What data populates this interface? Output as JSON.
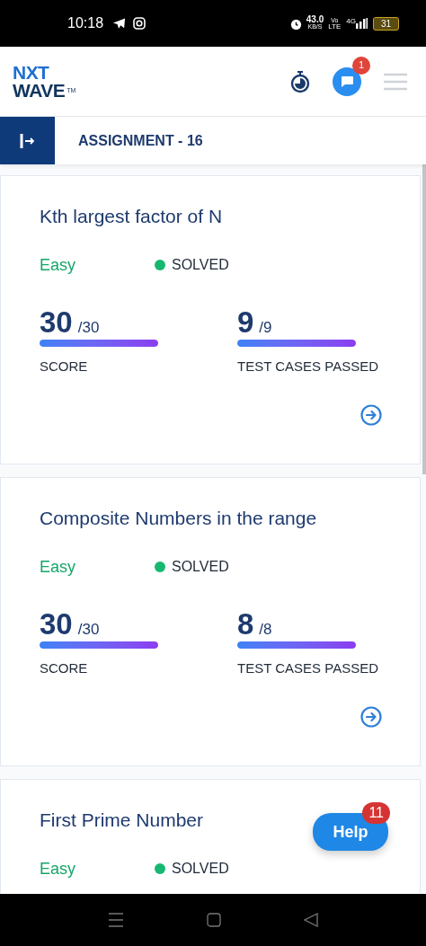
{
  "status_bar": {
    "time": "10:18",
    "speed": "43.0",
    "speed_unit": "KB/S",
    "volte_top": "Vo",
    "volte_bottom": "LTE",
    "network": "4G",
    "battery": "31"
  },
  "header": {
    "logo_top": "NXT",
    "logo_bottom": "WAVE",
    "trademark": "TM",
    "chat_badge": "1"
  },
  "assignment": {
    "title": "ASSIGNMENT - 16"
  },
  "problems": [
    {
      "title": "Kth largest factor of N",
      "difficulty": "Easy",
      "status": "SOLVED",
      "score": "30",
      "score_total": "/30",
      "score_label": "SCORE",
      "score_bar": {
        "level": 1
      },
      "tests": "9",
      "tests_total": "/9",
      "tests_label": "TEST CASES PASSED",
      "tests_bar": {
        "level": 1
      }
    },
    {
      "title": "Composite Numbers in the range",
      "difficulty": "Easy",
      "status": "SOLVED",
      "score": "30",
      "score_total": "/30",
      "score_label": "SCORE",
      "score_bar": {
        "level": 1
      },
      "tests": "8",
      "tests_total": "/8",
      "tests_label": "TEST CASES PASSED",
      "tests_bar": {
        "level": 1
      }
    },
    {
      "title": "First Prime Number",
      "difficulty": "Easy",
      "status": "SOLVED"
    }
  ],
  "help": {
    "label": "Help",
    "badge": "11"
  }
}
